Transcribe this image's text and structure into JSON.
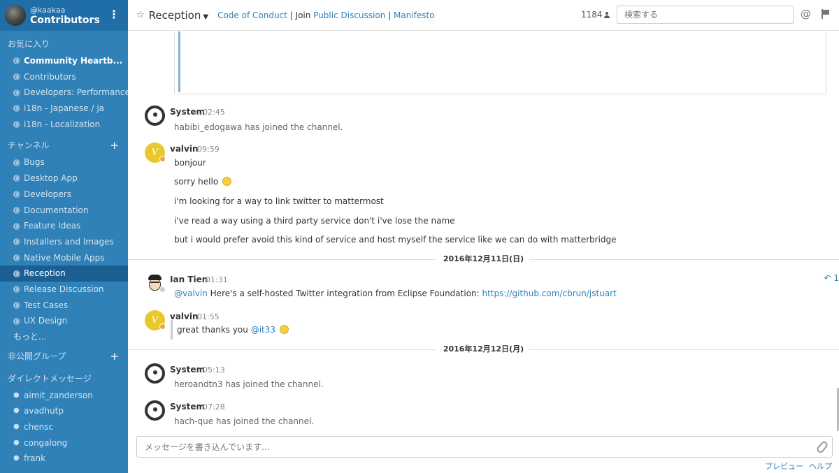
{
  "team": {
    "user": "@kaakaa",
    "name": "Contributors",
    "menu_icon": "⋮"
  },
  "sidebar": {
    "favorites": {
      "title": "お気に入り",
      "items": [
        {
          "label": "Community Heartb...",
          "bold": true
        },
        {
          "label": "Contributors"
        },
        {
          "label": "Developers: Performance"
        },
        {
          "label": "i18n - Japanese / ja"
        },
        {
          "label": "i18n - Localization"
        }
      ]
    },
    "channels": {
      "title": "チャンネル",
      "add": "+",
      "items": [
        {
          "label": "Bugs"
        },
        {
          "label": "Desktop App"
        },
        {
          "label": "Developers"
        },
        {
          "label": "Documentation"
        },
        {
          "label": "Feature Ideas"
        },
        {
          "label": "Installers and Images"
        },
        {
          "label": "Native Mobile Apps"
        },
        {
          "label": "Reception",
          "active": true
        },
        {
          "label": "Release Discussion"
        },
        {
          "label": "Test Cases"
        },
        {
          "label": "UX Design"
        }
      ],
      "more": "もっと..."
    },
    "private_groups": {
      "title": "非公開グループ",
      "add": "+"
    },
    "direct_messages": {
      "title": "ダイレクトメッセージ",
      "items": [
        {
          "label": "aimit_zanderson"
        },
        {
          "label": "avadhutp"
        },
        {
          "label": "chensc"
        },
        {
          "label": "congalong"
        },
        {
          "label": "frank"
        }
      ]
    }
  },
  "header": {
    "star": "☆",
    "channel": "Reception",
    "chevron": "⌄",
    "purpose_code": "Code of Conduct",
    "purpose_sep1": " | Join ",
    "purpose_public": "Public Discussion",
    "purpose_sep2": " | ",
    "purpose_manifesto": "Manifesto",
    "member_count": "1184",
    "search_placeholder": "検索する",
    "at": "@"
  },
  "posts": {
    "p1": {
      "name": "System",
      "time": "02:45",
      "text": "habibi_edogawa has joined the channel."
    },
    "p2": {
      "name": "valvin",
      "time": "09:59",
      "avatar_letter": "V",
      "lines": [
        "bonjour",
        "sorry hello",
        "i'm looking for a way to link twitter to mattermost",
        "i've read a way using a third party service don't i've lose the name",
        "but i would prefer avoid this kind of service and host myself the service like we can do with matterbridge"
      ]
    },
    "date1": "2016年12月11日(日)",
    "p3": {
      "name": "Ian Tien",
      "time": "01:31",
      "mention": "@valvin",
      "text": " Here's a self-hosted Twitter integration from Eclipse Foundation: ",
      "link": "https://github.com/cbrun/jstuart",
      "reply_count": "1"
    },
    "p4": {
      "name": "valvin",
      "time": "01:55",
      "avatar_letter": "V",
      "text": "great thanks you ",
      "mention": "@it33"
    },
    "date2": "2016年12月12日(月)",
    "p5": {
      "name": "System",
      "time": "05:13",
      "text": "heroandtn3 has joined the channel."
    },
    "p6": {
      "name": "System",
      "time": "07:28",
      "text": "hach-que has joined the channel."
    }
  },
  "footer": {
    "placeholder": "メッセージを書き込んでいます...",
    "preview": "プレビュー",
    "help": "ヘルプ"
  },
  "colors": {
    "sidebar": "#2f81b7",
    "sidebar_header": "#1f6ea8",
    "active": "#1b5f92",
    "link": "#2f81b7",
    "avatar_yellow": "#e9c82b"
  }
}
